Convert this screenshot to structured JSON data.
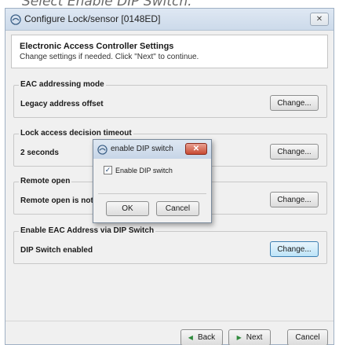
{
  "caption": "Select Enable DIP Switch.",
  "window": {
    "title": "Configure Lock/sensor [0148ED]",
    "close_glyph": "✕"
  },
  "header": {
    "title": "Electronic Access Controller Settings",
    "subtitle": "Change settings if needed. Click \"Next\" to continue."
  },
  "sections": [
    {
      "legend": "EAC addressing mode",
      "value": "Legacy address offset",
      "button": "Change..."
    },
    {
      "legend": "Lock access decision timeout",
      "value": "2 seconds",
      "button": "Change..."
    },
    {
      "legend": "Remote open",
      "value": "Remote open is not allowed",
      "button": "Change..."
    },
    {
      "legend": "Enable EAC Address via DIP Switch",
      "value": "DIP Switch enabled",
      "button": "Change..."
    }
  ],
  "footer": {
    "back": "Back",
    "next": "Next",
    "cancel": "Cancel"
  },
  "dialog": {
    "title": "enable DIP switch",
    "checkbox_label": "Enable DIP switch",
    "checkbox_checked": true,
    "ok": "OK",
    "cancel": "Cancel",
    "close_glyph": "✕",
    "check_glyph": "✓"
  }
}
